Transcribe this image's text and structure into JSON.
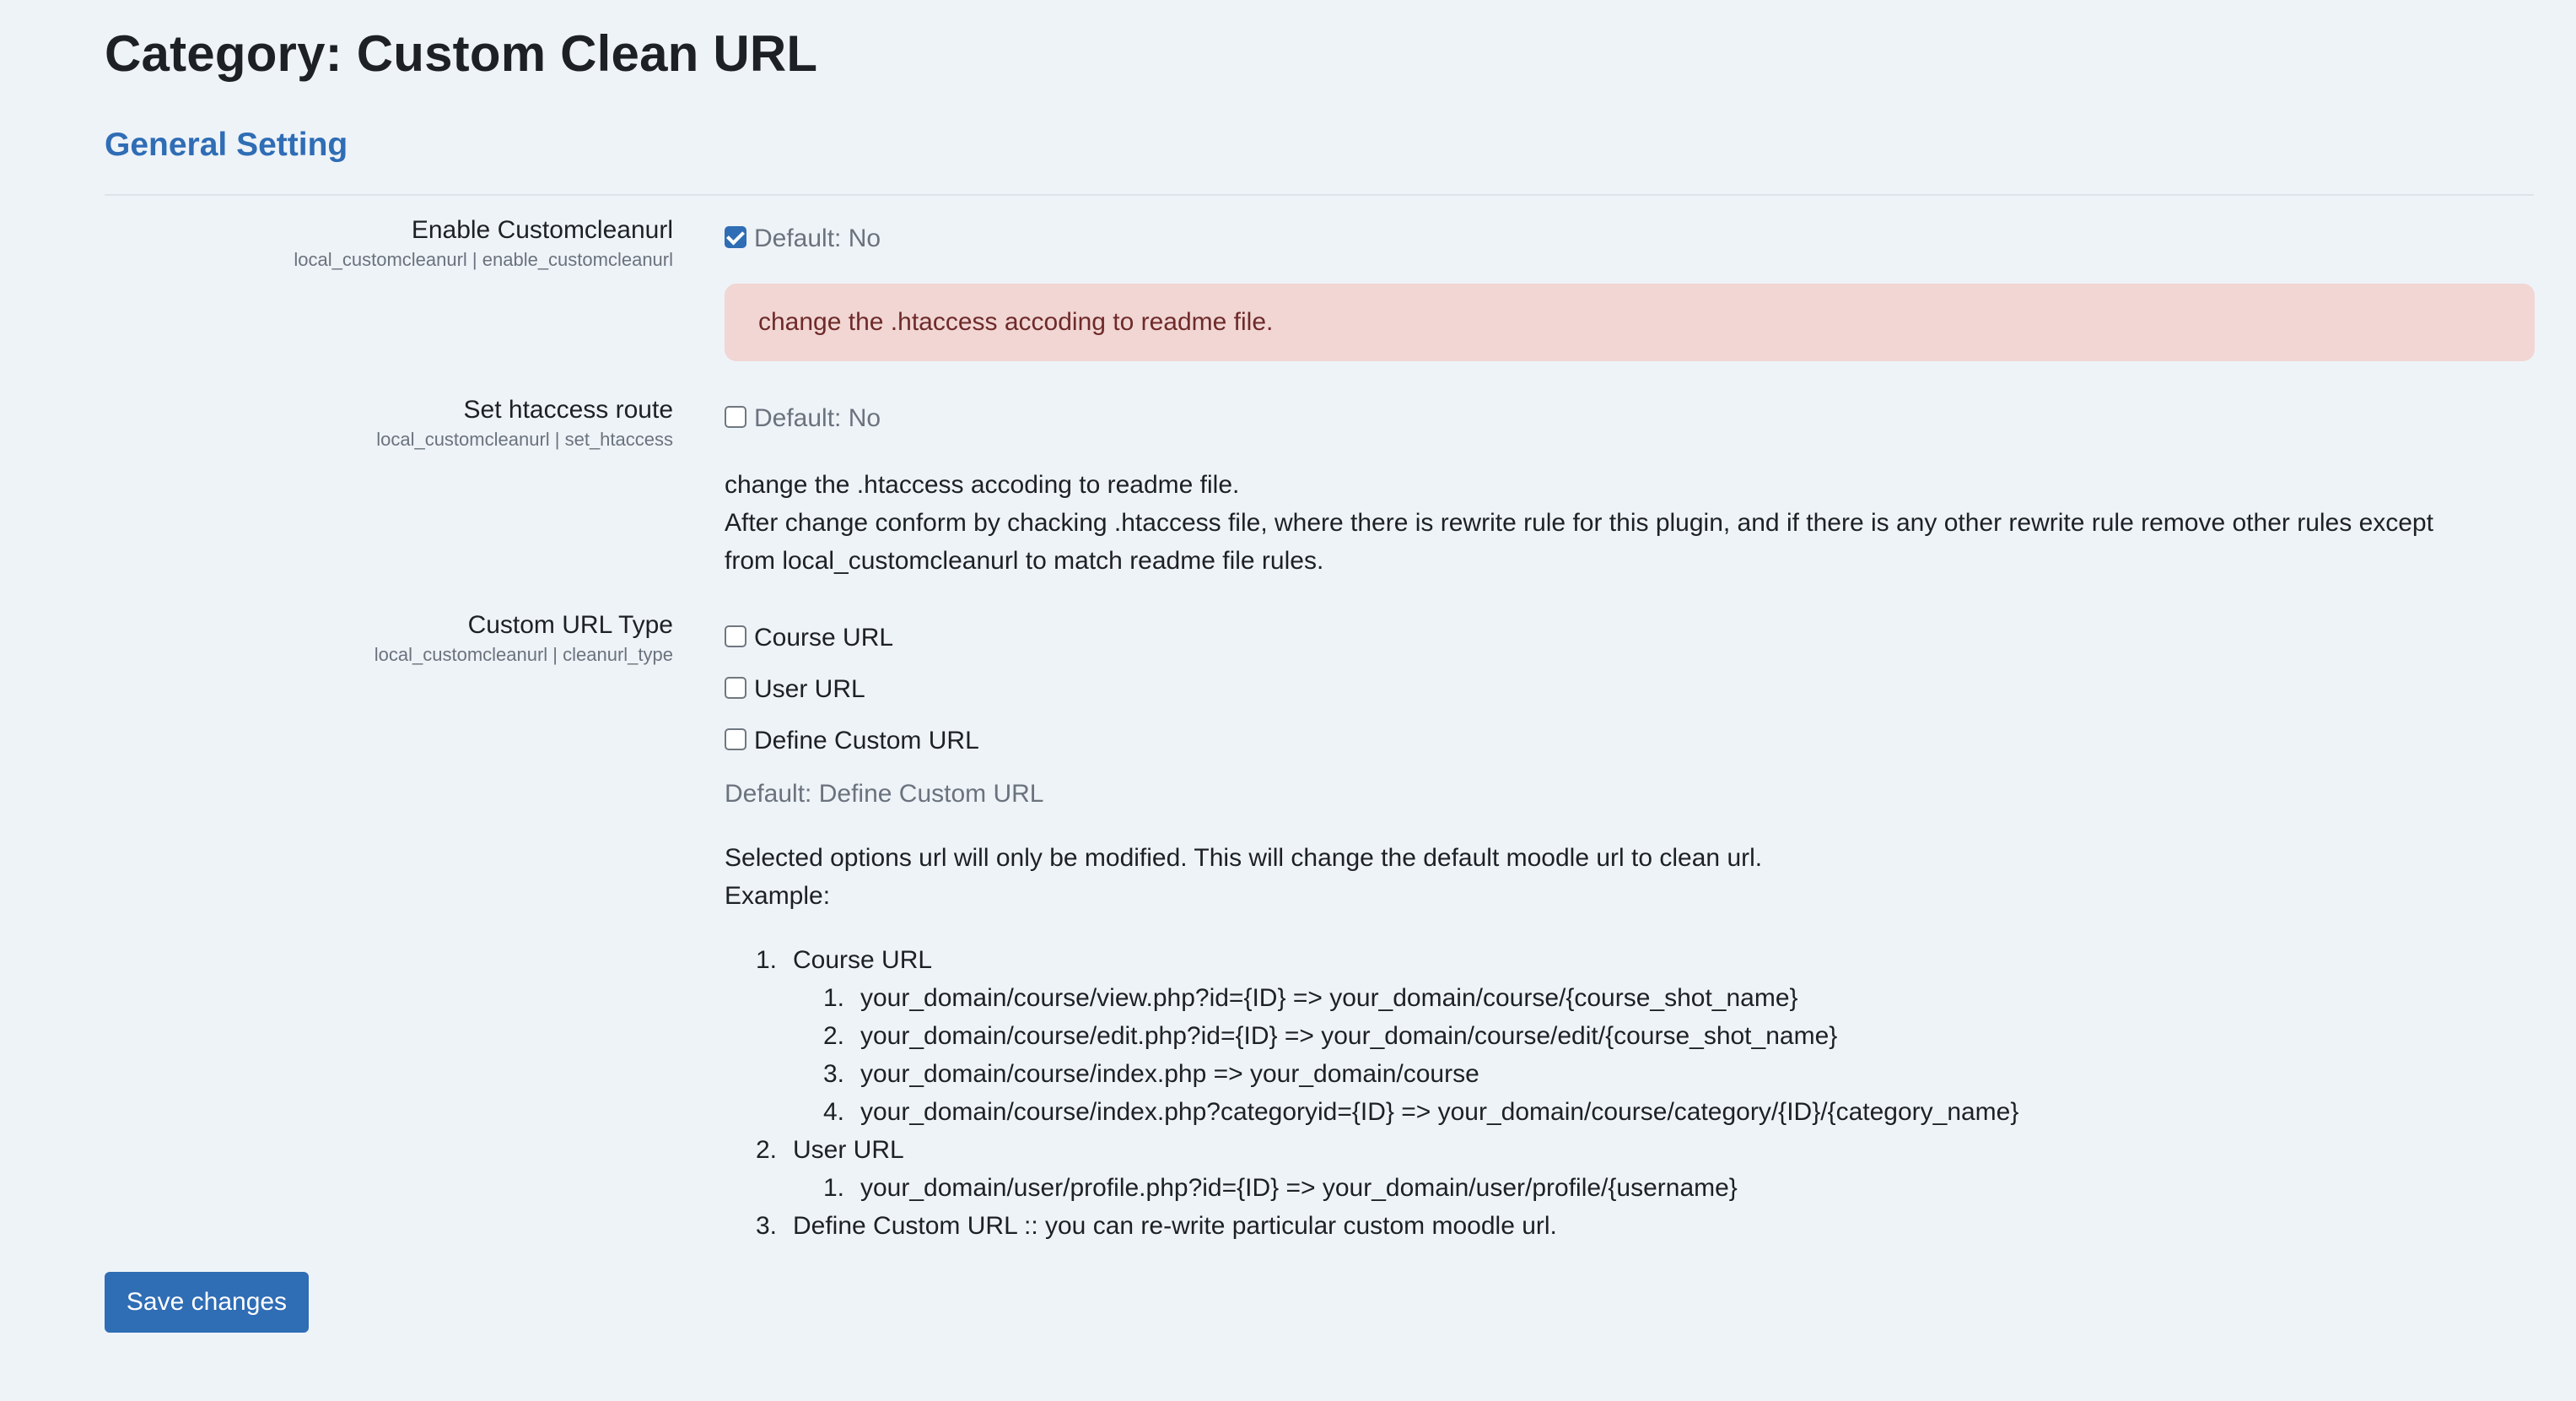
{
  "page": {
    "title": "Category: Custom Clean URL",
    "section_title": "General Setting"
  },
  "settings": {
    "enable_customcleanurl": {
      "label": "Enable Customcleanurl",
      "name": "local_customcleanurl | enable_customcleanurl",
      "checked": true,
      "default_text": "Default: No",
      "alert": "change the .htaccess accoding to readme file."
    },
    "set_htaccess": {
      "label": "Set htaccess route",
      "name": "local_customcleanurl | set_htaccess",
      "checked": false,
      "default_text": "Default: No",
      "description_line_1": "change the .htaccess accoding to readme file.",
      "description_line_2": "After change conform by chacking .htaccess file, where there is rewrite rule for this plugin, and if there is any other rewrite rule remove other rules except",
      "description_line_3": "from local_customcleanurl to match readme file rules."
    },
    "cleanurl_type": {
      "label": "Custom URL Type",
      "name": "local_customcleanurl | cleanurl_type",
      "options": [
        {
          "label": "Course URL",
          "checked": false
        },
        {
          "label": "User URL",
          "checked": false
        },
        {
          "label": "Define Custom URL",
          "checked": false
        }
      ],
      "default_text": "Default: Define Custom URL",
      "description_line_1": "Selected options url will only be modified. This will change the default moodle url to clean url.",
      "description_line_2": "Example:"
    }
  },
  "url_examples": {
    "items": [
      {
        "number": "1.",
        "label": "Course URL",
        "sub_items": [
          {
            "number": "1.",
            "text": "your_domain/course/view.php?id={ID} => your_domain/course/{course_shot_name}"
          },
          {
            "number": "2.",
            "text": "your_domain/course/edit.php?id={ID} => your_domain/course/edit/{course_shot_name}"
          },
          {
            "number": "3.",
            "text": "your_domain/course/index.php => your_domain/course"
          },
          {
            "number": "4.",
            "text": "your_domain/course/index.php?categoryid={ID} => your_domain/course/category/{ID}/{category_name}"
          }
        ]
      },
      {
        "number": "2.",
        "label": "User URL",
        "sub_items": [
          {
            "number": "1.",
            "text": "your_domain/user/profile.php?id={ID} => your_domain/user/profile/{username}"
          }
        ]
      },
      {
        "number": "3.",
        "label": "Define Custom URL :: you can re-write particular custom moodle url.",
        "sub_items": []
      }
    ]
  },
  "actions": {
    "save_label": "Save changes"
  },
  "colors": {
    "page_background": "#eef3f8",
    "primary": "#2f6db5",
    "alert_background": "#f1d6d3",
    "alert_text": "#6e2a2a",
    "muted_text": "#6a737d"
  }
}
